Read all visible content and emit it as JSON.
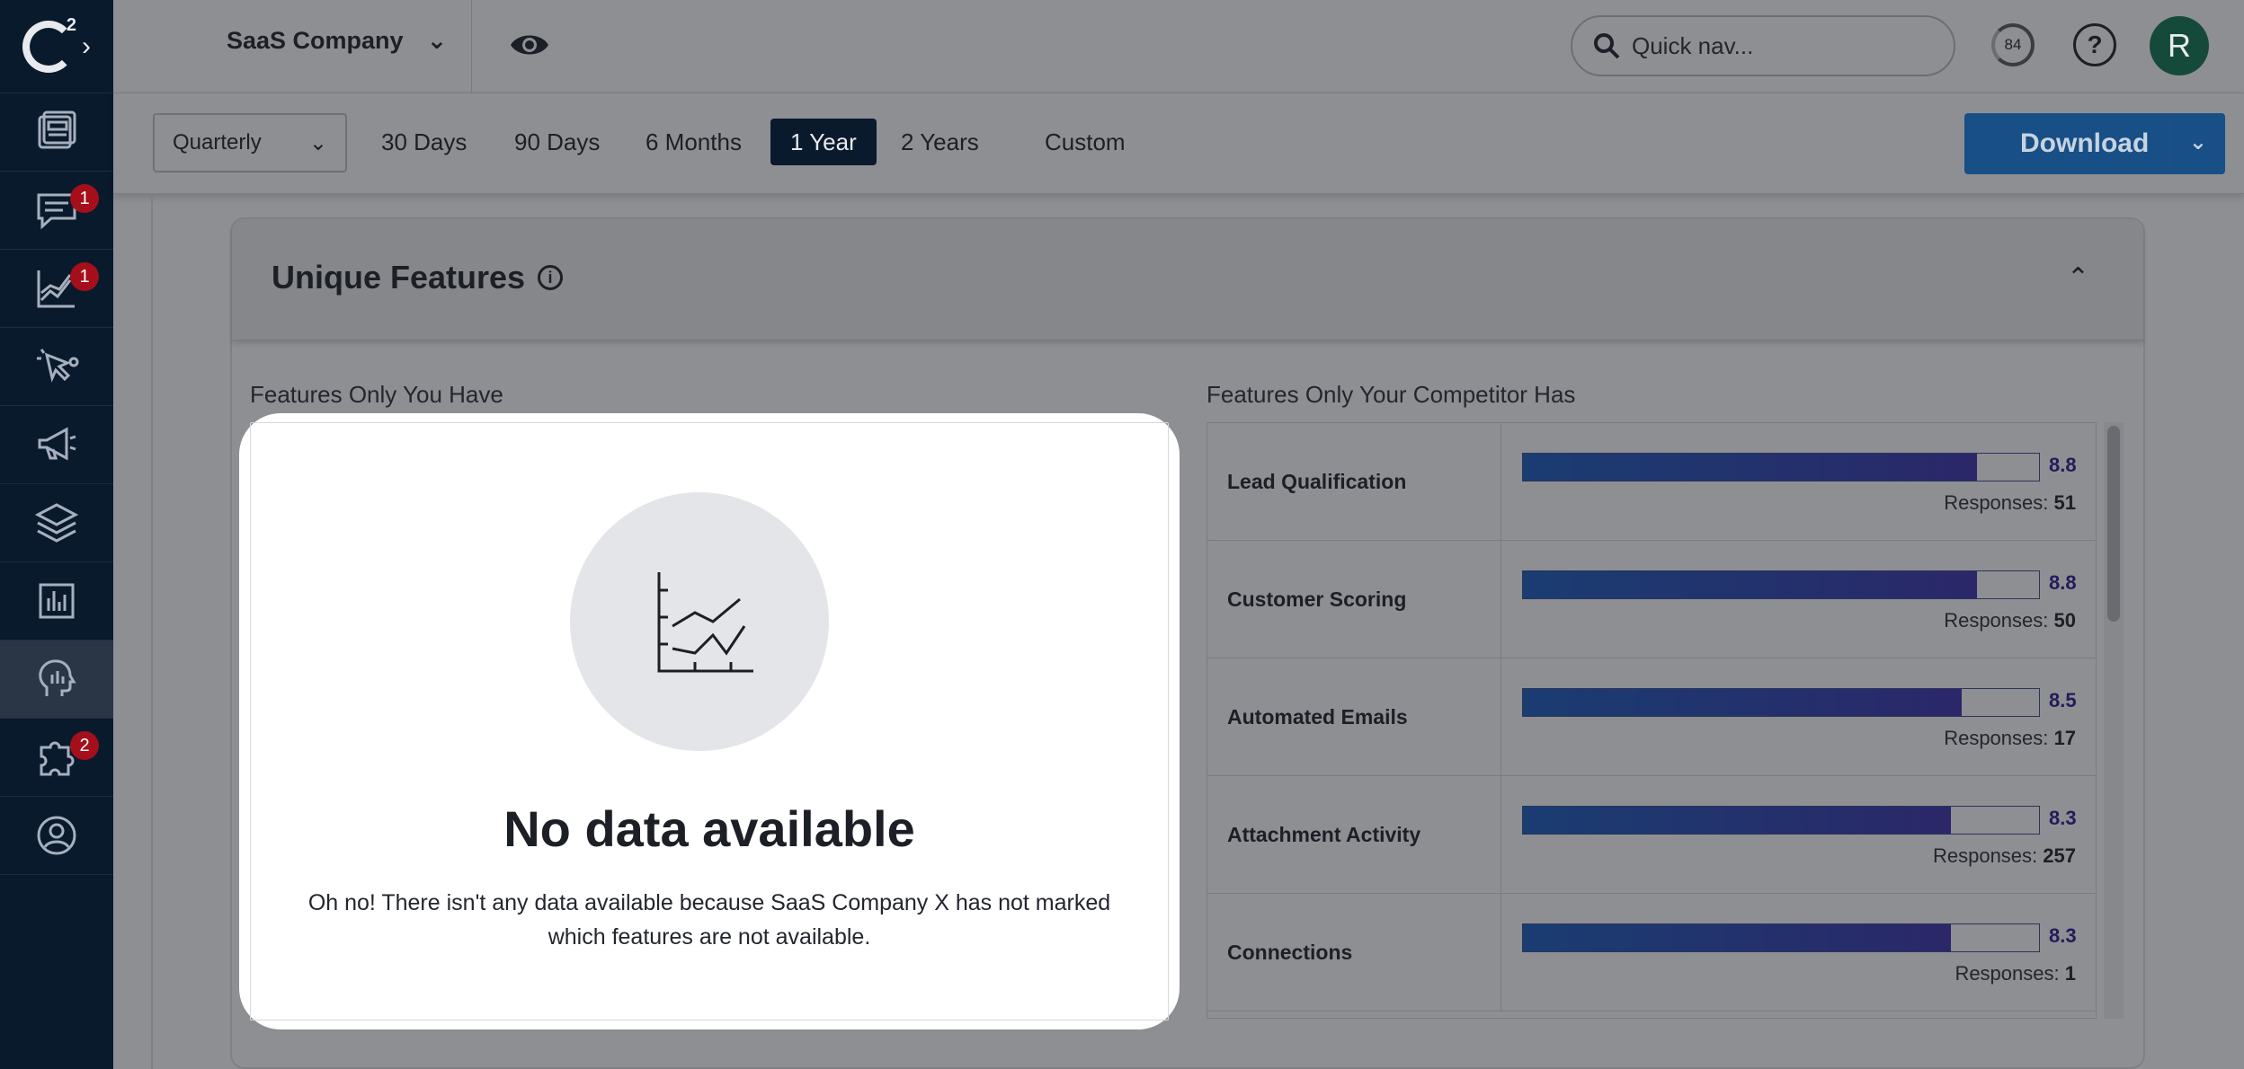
{
  "sidebar": {
    "logo": "G2",
    "items": [
      {
        "icon": "reports-icon",
        "badge": ""
      },
      {
        "icon": "messages-icon",
        "badge": "1"
      },
      {
        "icon": "analytics-icon",
        "badge": "1"
      },
      {
        "icon": "clicks-icon",
        "badge": ""
      },
      {
        "icon": "megaphone-icon",
        "badge": ""
      },
      {
        "icon": "layers-icon",
        "badge": ""
      },
      {
        "icon": "bar-chart-icon",
        "badge": ""
      },
      {
        "icon": "head-insights-icon",
        "badge": ""
      },
      {
        "icon": "puzzle-icon",
        "badge": "2"
      },
      {
        "icon": "profile-icon",
        "badge": ""
      }
    ]
  },
  "header": {
    "company": "SaaS Company",
    "search_placeholder": "Quick nav...",
    "score": "84",
    "help": "?",
    "avatar_initial": "R"
  },
  "filters": {
    "period": "Quarterly",
    "ranges": [
      "30 Days",
      "90 Days",
      "6 Months",
      "1 Year",
      "2 Years",
      "Custom"
    ],
    "selected_range": "1 Year",
    "download_label": "Download"
  },
  "card": {
    "title": "Unique Features",
    "left_label": "Features Only You Have",
    "right_label": "Features Only Your Competitor Has"
  },
  "empty_state": {
    "title": "No data available",
    "description": "Oh no! There isn't any data available because SaaS Company X has not marked which features are not available."
  },
  "competitor_features": [
    {
      "name": "Lead Qualification",
      "score": "8.8",
      "fraction": 0.88,
      "responses_label": "Responses:",
      "responses": "51"
    },
    {
      "name": "Customer Scoring",
      "score": "8.8",
      "fraction": 0.88,
      "responses_label": "Responses:",
      "responses": "50"
    },
    {
      "name": "Automated Emails",
      "score": "8.5",
      "fraction": 0.85,
      "responses_label": "Responses:",
      "responses": "17"
    },
    {
      "name": "Attachment Activity",
      "score": "8.3",
      "fraction": 0.83,
      "responses_label": "Responses:",
      "responses": "257"
    },
    {
      "name": "Connections",
      "score": "8.3",
      "fraction": 0.83,
      "responses_label": "Responses:",
      "responses": "1"
    }
  ],
  "colors": {
    "sidebar": "#0a1a2d",
    "download": "#174f86",
    "selected_range": "#0a1a2d",
    "badge": "#a40f1b"
  }
}
